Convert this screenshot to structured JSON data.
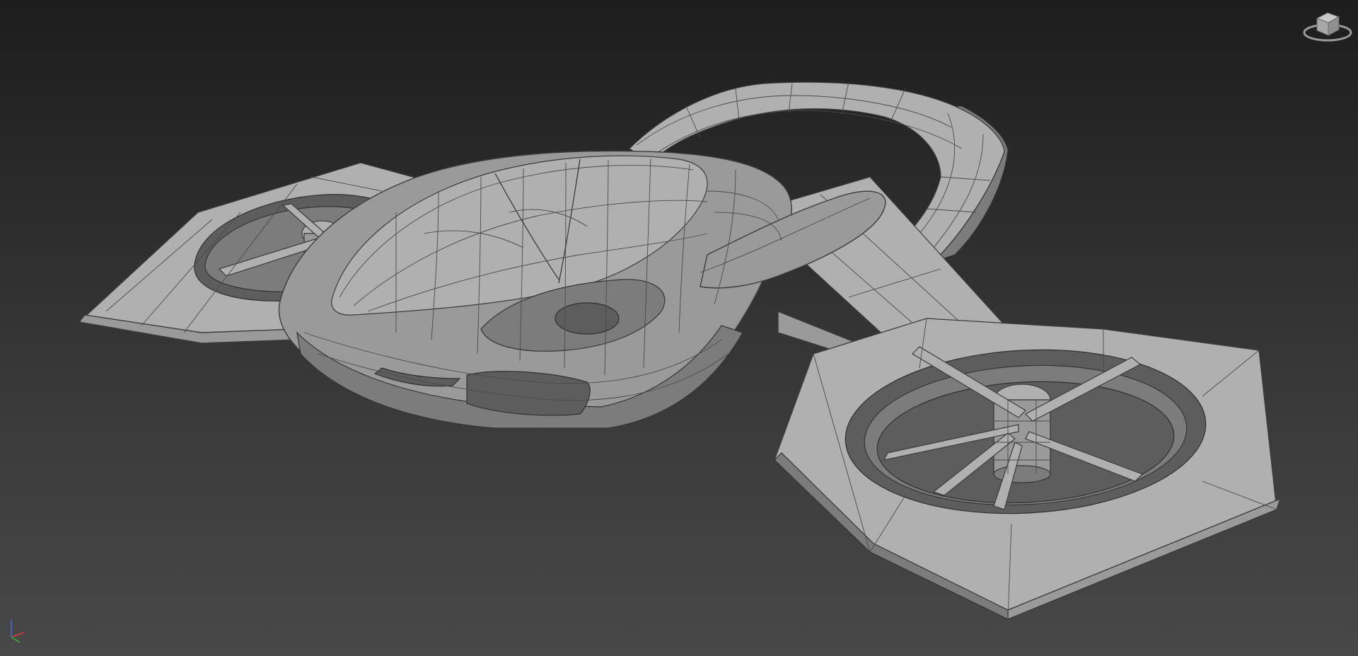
{
  "viewport": {
    "background_top": "#1d1d1d",
    "background_bottom": "#484848",
    "mesh_color": "#9a9a9a",
    "wire_color": "#3c3c3c"
  },
  "icons": {
    "viewcube": "viewcube-icon",
    "axis": "axis-tripod-icon"
  },
  "axis_colors": {
    "x": "#d23b3b",
    "y": "#3bb33b",
    "z": "#3b6fd2"
  }
}
